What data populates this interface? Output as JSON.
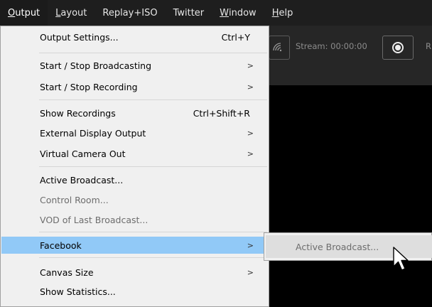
{
  "menubar": {
    "items": [
      {
        "label": "Output",
        "mnemonic": "O",
        "rest": "utput",
        "active": true
      },
      {
        "label": "Layout",
        "mnemonic": "L",
        "rest": "ayout"
      },
      {
        "label": "Replay+ISO"
      },
      {
        "label": "Twitter"
      },
      {
        "label": "Window",
        "mnemonic": "W",
        "rest": "indow"
      },
      {
        "label": "Help",
        "mnemonic": "H",
        "rest": "elp"
      }
    ]
  },
  "toolbar": {
    "stream_label": "Stream: 00:00:00",
    "rec_label_partial": "R",
    "icons": [
      "wireless-icon",
      "record-icon"
    ]
  },
  "output_menu": {
    "items": [
      {
        "label": "Output Settings...",
        "shortcut": "Ctrl+Y"
      },
      {
        "label": "Start / Stop Broadcasting",
        "submenu": true
      },
      {
        "label": "Start / Stop Recording",
        "submenu": true
      },
      {
        "label": "Show Recordings",
        "shortcut": "Ctrl+Shift+R"
      },
      {
        "label": "External Display Output",
        "submenu": true
      },
      {
        "label": "Virtual Camera Out",
        "submenu": true
      },
      {
        "label": "Active Broadcast..."
      },
      {
        "label": "Control Room...",
        "disabled": true
      },
      {
        "label": "VOD of Last Broadcast...",
        "disabled": true
      },
      {
        "label": "Facebook",
        "submenu": true,
        "highlighted": true
      },
      {
        "label": "Canvas Size",
        "submenu": true
      },
      {
        "label": "Show Statistics..."
      }
    ],
    "arrow_glyph": ">"
  },
  "facebook_submenu": {
    "items": [
      {
        "label": "Active Broadcast...",
        "disabled": true,
        "hovered": true
      }
    ]
  },
  "colors": {
    "menubar_bg": "#1e1e1e",
    "menu_bg": "#f0f0f0",
    "highlight": "#91c9f7",
    "disabled_text": "#6d6d6d"
  }
}
